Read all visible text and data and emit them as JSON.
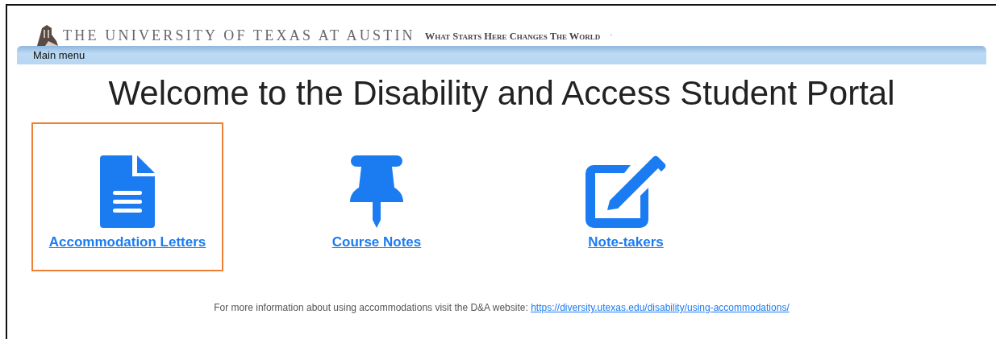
{
  "header": {
    "university": "THE UNIVERSITY OF TEXAS AT AUSTIN",
    "tagline": "What Starts Here Changes The World",
    "mark": "-"
  },
  "menu_bar": {
    "label": "Main menu"
  },
  "heading": "Welcome to the Disability and Access Student Portal",
  "tiles": [
    {
      "kind": "document",
      "label": "Accommodation Letters",
      "selected": true
    },
    {
      "kind": "pin",
      "label": "Course Notes",
      "selected": false
    },
    {
      "kind": "edit",
      "label": "Note-takers",
      "selected": false
    }
  ],
  "footer": {
    "text": "For more information about using accommodations visit the D&A website:",
    "link": "https://diversity.utexas.edu/disability/using-accommodations/"
  }
}
